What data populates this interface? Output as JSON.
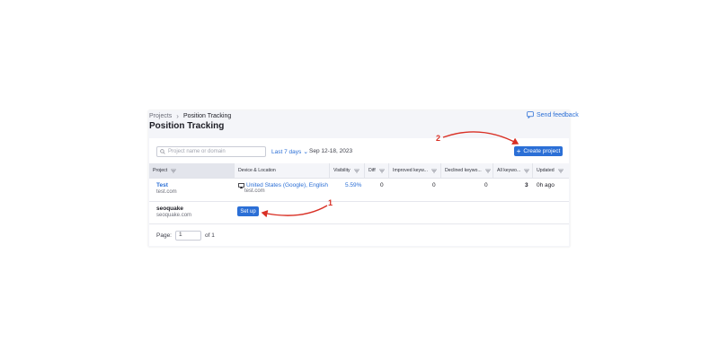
{
  "breadcrumb": {
    "root": "Projects",
    "current": "Position Tracking"
  },
  "header": {
    "title": "Position Tracking",
    "feedback_label": "Send feedback"
  },
  "toolbar": {
    "search_placeholder": "Project name or domain",
    "range_label": "Last 7 days",
    "date_range": "Sep 12-18, 2023",
    "create_label": "Create project"
  },
  "table": {
    "columns": [
      "Project",
      "Device & Location",
      "Visibility",
      "Diff",
      "Improved keyw...",
      "Declined keywo...",
      "All keywo...",
      "Updated"
    ],
    "rows": [
      {
        "name": "Test",
        "domain": "test.com",
        "location": "United States (Google), English",
        "location_domain": "test.com",
        "visibility": "5.59%",
        "diff": "0",
        "improved": "0",
        "declined": "0",
        "all": "3",
        "updated": "0h ago"
      },
      {
        "name": "seoquake",
        "domain": "seoquake.com",
        "setup_label": "Set up"
      }
    ]
  },
  "pager": {
    "label": "Page:",
    "value": "1",
    "of": "of 1"
  },
  "annotations": {
    "one": "1",
    "two": "2",
    "color": "#d93025"
  },
  "colors": {
    "accent": "#2b6fd6"
  }
}
